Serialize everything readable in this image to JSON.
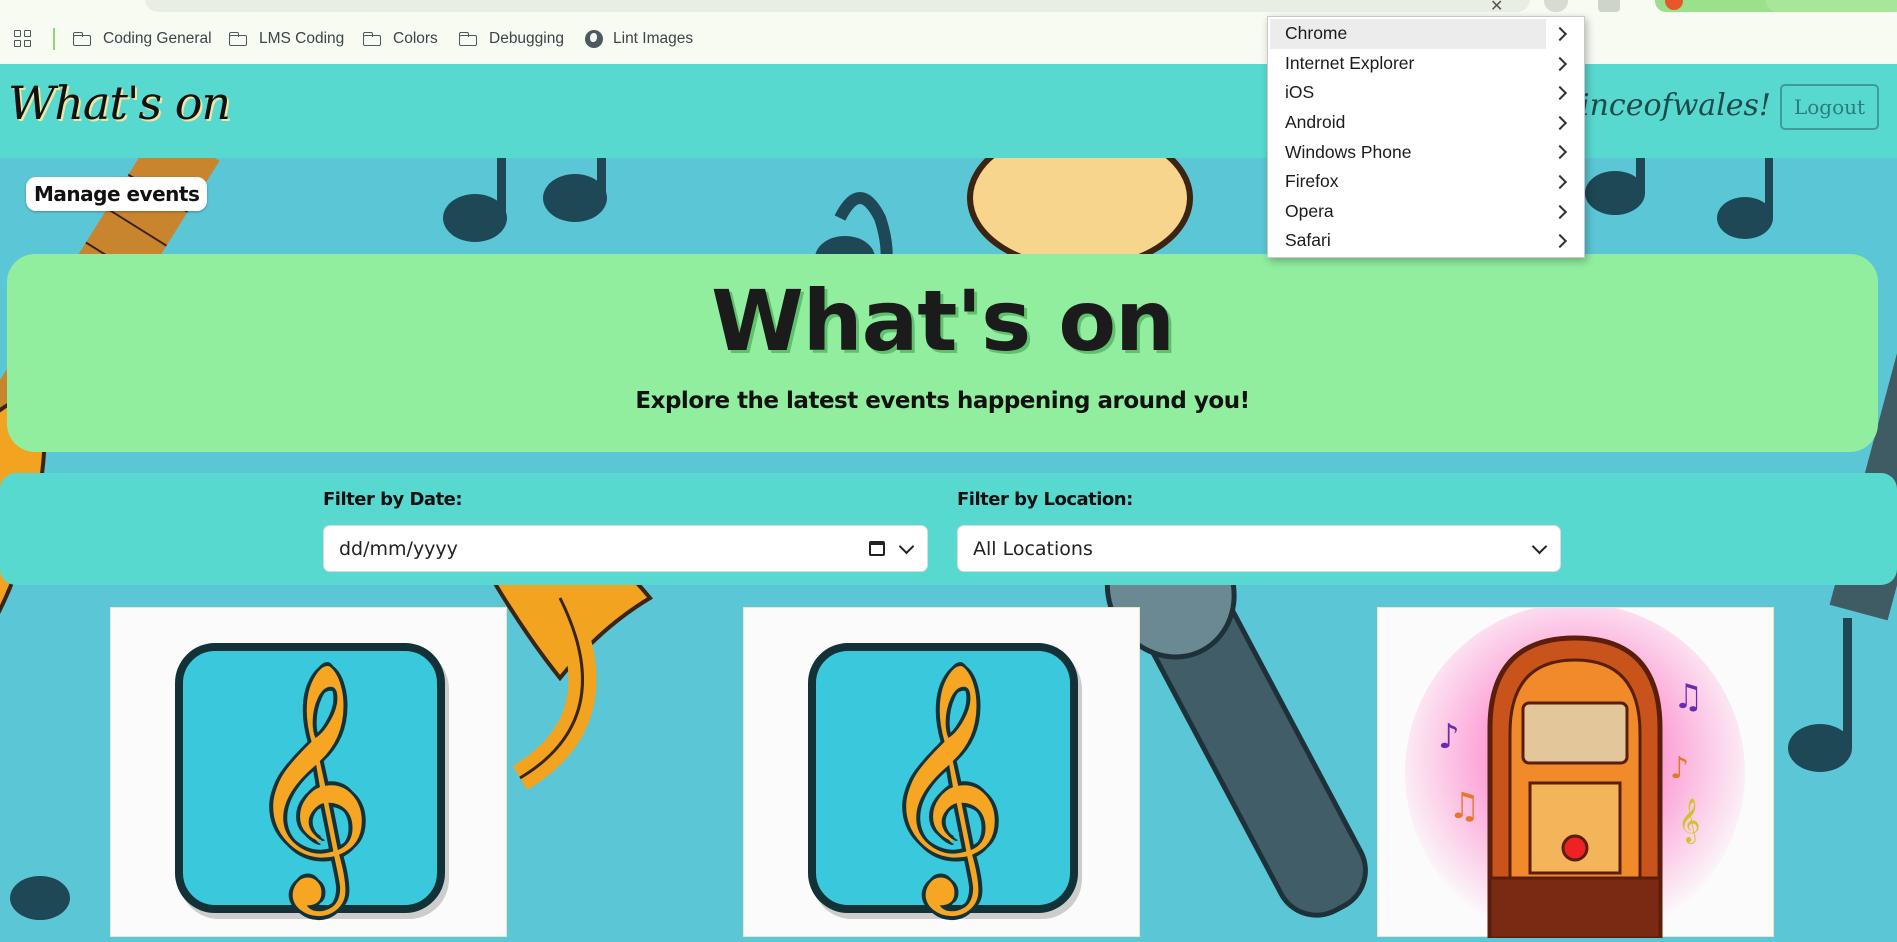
{
  "bookmarks": [
    {
      "label": "Coding General",
      "icon": "folder-icon"
    },
    {
      "label": "LMS Coding",
      "icon": "folder-icon"
    },
    {
      "label": "Colors",
      "icon": "folder-icon"
    },
    {
      "label": "Debugging",
      "icon": "folder-icon"
    },
    {
      "label": "Lint Images",
      "icon": "globe-icon"
    }
  ],
  "site": {
    "logo": "What's on",
    "greeting": ", Princeofwales!",
    "logout_label": "Logout",
    "manage_label": "Manage events"
  },
  "hero": {
    "title": "What's on",
    "subtitle": "Explore the latest events happening around you!"
  },
  "filters": {
    "date_label": "Filter by Date:",
    "date_placeholder": "dd/mm/yyyy",
    "location_label": "Filter by Location:",
    "location_value": "All Locations"
  },
  "cards": [
    {
      "image": "treble-clef-tile"
    },
    {
      "image": "treble-clef-tile"
    },
    {
      "image": "jukebox-illustration"
    }
  ],
  "context_menu": {
    "items": [
      "Chrome",
      "Internet Explorer",
      "iOS",
      "Android",
      "Windows Phone",
      "Firefox",
      "Opera",
      "Safari"
    ],
    "highlighted": "Chrome"
  },
  "colors": {
    "header_bg": "#58d9d0",
    "hero_bg": "#91ee9f",
    "page_bg": "#5bc6d6",
    "clef": "#f6a623"
  }
}
